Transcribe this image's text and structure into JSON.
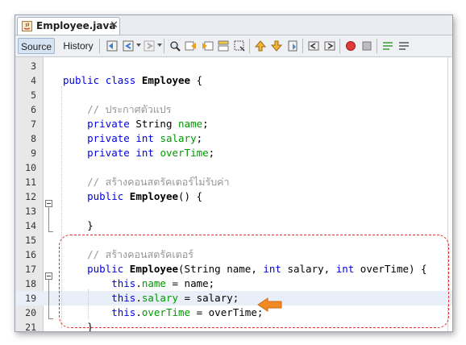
{
  "tab": {
    "title": "Employee.java",
    "close": "✕"
  },
  "toolbar": {
    "source": "Source",
    "history": "History"
  },
  "lines": [
    {
      "num": "3"
    },
    {
      "num": "4",
      "tokens": [
        [
          "kw",
          "public"
        ],
        [
          "p",
          " "
        ],
        [
          "kw",
          "class"
        ],
        [
          "p",
          " "
        ],
        [
          "b",
          "Employee"
        ],
        [
          "p",
          " {"
        ]
      ]
    },
    {
      "num": "5"
    },
    {
      "num": "6",
      "tokens": [
        [
          "p",
          "    "
        ],
        [
          "cm",
          "// ประกาศตัวแปร"
        ]
      ]
    },
    {
      "num": "7",
      "tokens": [
        [
          "p",
          "    "
        ],
        [
          "kw",
          "private"
        ],
        [
          "p",
          " String "
        ],
        [
          "fld",
          "name"
        ],
        [
          "p",
          ";"
        ]
      ]
    },
    {
      "num": "8",
      "tokens": [
        [
          "p",
          "    "
        ],
        [
          "kw",
          "private"
        ],
        [
          "p",
          " "
        ],
        [
          "kw",
          "int"
        ],
        [
          "p",
          " "
        ],
        [
          "fld",
          "salary"
        ],
        [
          "p",
          ";"
        ]
      ]
    },
    {
      "num": "9",
      "tokens": [
        [
          "p",
          "    "
        ],
        [
          "kw",
          "private"
        ],
        [
          "p",
          " "
        ],
        [
          "kw",
          "int"
        ],
        [
          "p",
          " "
        ],
        [
          "fld",
          "overTime"
        ],
        [
          "p",
          ";"
        ]
      ]
    },
    {
      "num": "10"
    },
    {
      "num": "11",
      "tokens": [
        [
          "p",
          "    "
        ],
        [
          "cm",
          "// สร้างคอนสตรัคเตอร์ไม่รับค่า"
        ]
      ]
    },
    {
      "num": "12",
      "tokens": [
        [
          "p",
          "    "
        ],
        [
          "kw",
          "public"
        ],
        [
          "p",
          " "
        ],
        [
          "b",
          "Employee"
        ],
        [
          "p",
          "() {"
        ]
      ]
    },
    {
      "num": "13"
    },
    {
      "num": "14",
      "tokens": [
        [
          "p",
          "    }"
        ]
      ]
    },
    {
      "num": "15"
    },
    {
      "num": "16",
      "tokens": [
        [
          "p",
          "    "
        ],
        [
          "cm",
          "// สร้างคอนสตรัคเตอร์"
        ]
      ]
    },
    {
      "num": "17",
      "tokens": [
        [
          "p",
          "    "
        ],
        [
          "kw",
          "public"
        ],
        [
          "p",
          " "
        ],
        [
          "b",
          "Employee"
        ],
        [
          "p",
          "(String name, "
        ],
        [
          "kw",
          "int"
        ],
        [
          "p",
          " salary, "
        ],
        [
          "kw",
          "int"
        ],
        [
          "p",
          " overTime) {"
        ]
      ]
    },
    {
      "num": "18",
      "tokens": [
        [
          "p",
          "        "
        ],
        [
          "kw",
          "this"
        ],
        [
          "p",
          "."
        ],
        [
          "fld",
          "name"
        ],
        [
          "p",
          " = name;"
        ]
      ]
    },
    {
      "num": "19",
      "tokens": [
        [
          "p",
          "        "
        ],
        [
          "kw",
          "this"
        ],
        [
          "p",
          "."
        ],
        [
          "fld",
          "salary"
        ],
        [
          "p",
          " = salary;"
        ]
      ]
    },
    {
      "num": "20",
      "tokens": [
        [
          "p",
          "        "
        ],
        [
          "kw",
          "this"
        ],
        [
          "p",
          "."
        ],
        [
          "fld",
          "overTime"
        ],
        [
          "p",
          " = overTime;"
        ]
      ]
    },
    {
      "num": "21",
      "tokens": [
        [
          "p",
          "    }"
        ]
      ]
    }
  ],
  "highlighted_line": "19",
  "colors": {
    "keyword": "#0000e6",
    "field": "#009900",
    "comment": "#969696",
    "highlight": "#e9eff8",
    "annotation": "#e0302a",
    "arrow": "#f08a24"
  }
}
